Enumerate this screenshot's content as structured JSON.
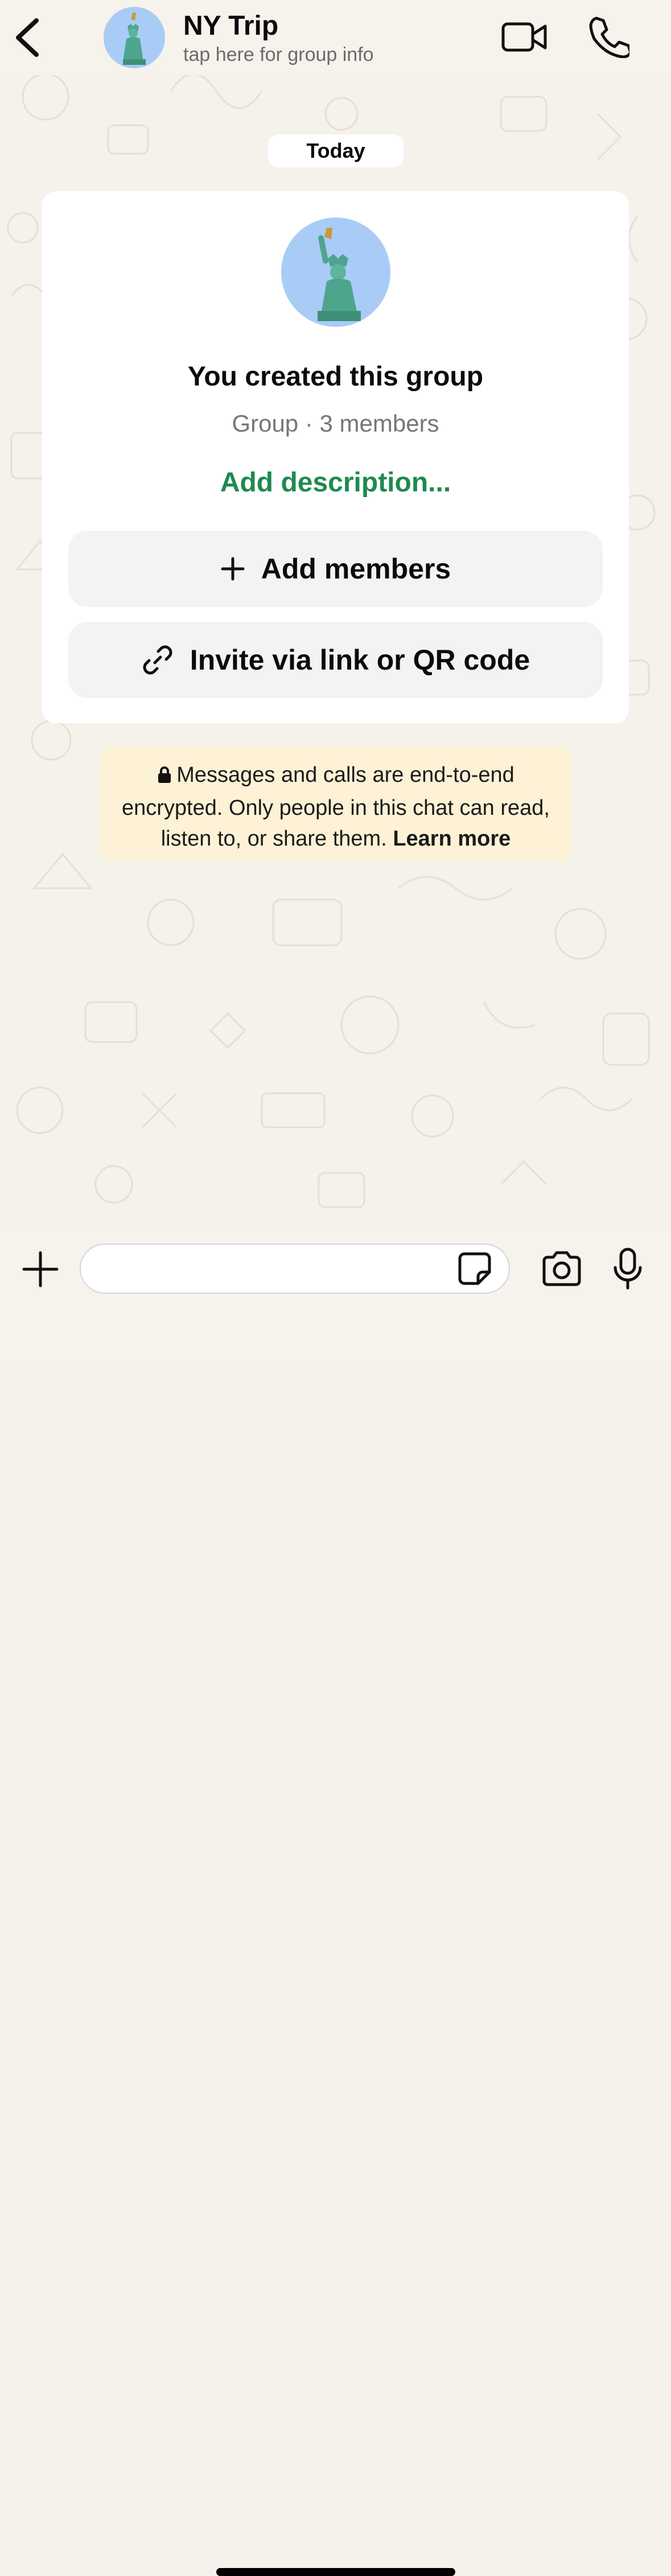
{
  "header": {
    "title": "NY Trip",
    "subtitle": "tap here for group info",
    "avatar_icon": "statue-of-liberty-icon"
  },
  "date_separator": "Today",
  "group_card": {
    "created_text": "You created this group",
    "meta": "Group · 3 members",
    "add_description": "Add description...",
    "add_members_label": "Add members",
    "invite_label": "Invite via link or QR code"
  },
  "encryption_notice": {
    "text": "Messages and calls are end-to-end encrypted. Only people in this chat can read, listen to, or share them.",
    "link": "Learn more"
  },
  "composer": {
    "placeholder": ""
  },
  "colors": {
    "accent_green": "#1e8a4f",
    "background": "#f5f1eb",
    "notice_bg": "#fdf1d6",
    "avatar_bg": "#a9ccf7"
  }
}
